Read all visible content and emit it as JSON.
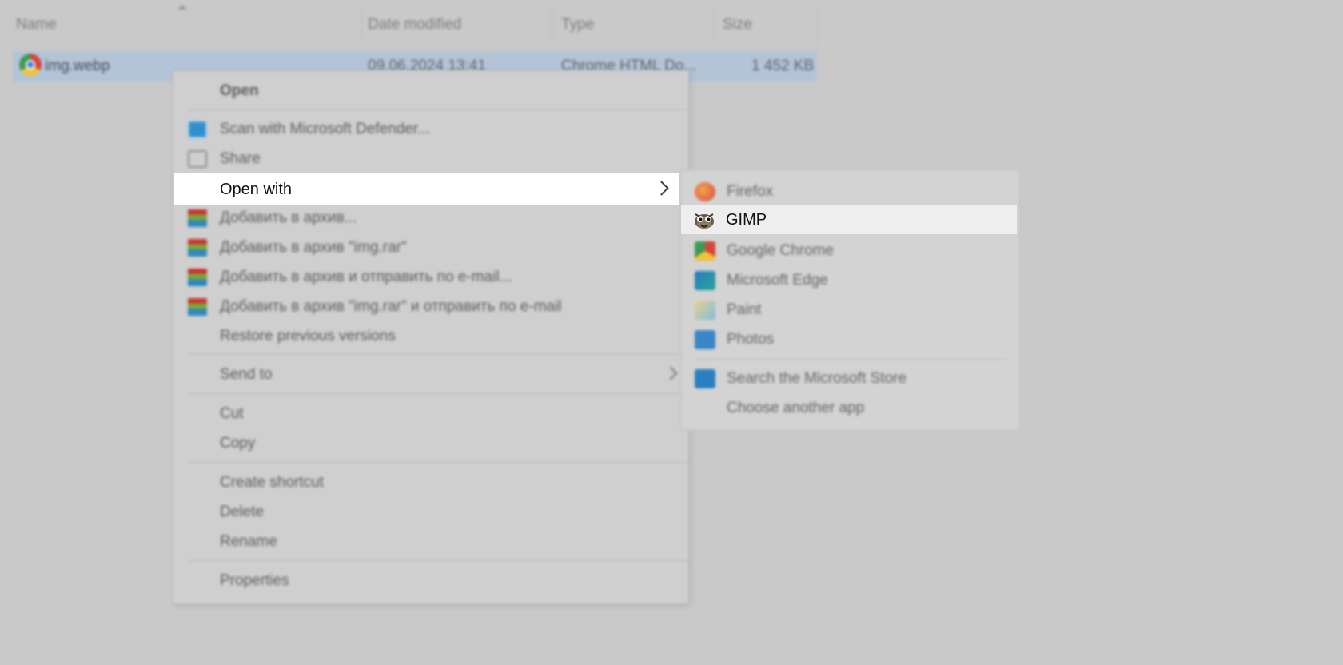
{
  "explorer": {
    "columns": [
      "Name",
      "Date modified",
      "Type",
      "Size"
    ],
    "file": {
      "name": "img.webp",
      "date": "09.06.2024 13:41",
      "type": "Chrome HTML Do...",
      "size": "1 452 KB",
      "icon": "chrome-icon"
    }
  },
  "context_menu": {
    "open": "Open",
    "scan": "Scan with Microsoft Defender...",
    "share": "Share",
    "open_with": "Open with",
    "add_archive": "Добавить в архив...",
    "add_archive_rar": "Добавить в архив \"img.rar\"",
    "add_archive_email": "Добавить в архив и отправить по e-mail...",
    "add_archive_rar_email": "Добавить в архив \"img.rar\" и отправить по e-mail",
    "restore": "Restore previous versions",
    "send_to": "Send to",
    "cut": "Cut",
    "copy": "Copy",
    "create_shortcut": "Create shortcut",
    "delete": "Delete",
    "rename": "Rename",
    "properties": "Properties"
  },
  "open_with_submenu": {
    "firefox": "Firefox",
    "gimp": "GIMP",
    "chrome": "Google Chrome",
    "edge": "Microsoft Edge",
    "paint": "Paint",
    "photos": "Photos",
    "store": "Search the Microsoft Store",
    "choose": "Choose another app"
  }
}
